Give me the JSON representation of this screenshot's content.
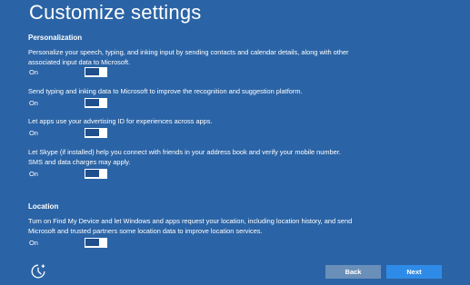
{
  "page": {
    "title": "Customize settings"
  },
  "personalization": {
    "heading": "Personalization",
    "items": [
      {
        "description": "Personalize your speech, typing, and inking input by sending contacts and calendar details, along with other associated input data to Microsoft.",
        "toggle_label": "On",
        "toggle_on": true
      },
      {
        "description": "Send typing and inking data to Microsoft to improve the recognition and suggestion platform.",
        "toggle_label": "On",
        "toggle_on": true
      },
      {
        "description": "Let apps use your advertising ID for experiences across apps.",
        "toggle_label": "On",
        "toggle_on": true
      },
      {
        "description": "Let Skype (if installed) help you connect with friends in your address book and verify your mobile number. SMS and data charges may apply.",
        "toggle_label": "On",
        "toggle_on": true
      }
    ]
  },
  "location": {
    "heading": "Location",
    "items": [
      {
        "description": "Turn on Find My Device and let Windows and apps request your location, including location history, and send Microsoft and trusted partners some location data to improve location services.",
        "toggle_label": "On",
        "toggle_on": true
      }
    ]
  },
  "footer": {
    "accessibility_icon": "ease-of-access-icon",
    "back_label": "Back",
    "next_label": "Next"
  },
  "colors": {
    "background": "#2b64a6",
    "toggle_track": "#1f4f8c",
    "back_button": "#6a8fb9",
    "next_button": "#2f8be8"
  }
}
